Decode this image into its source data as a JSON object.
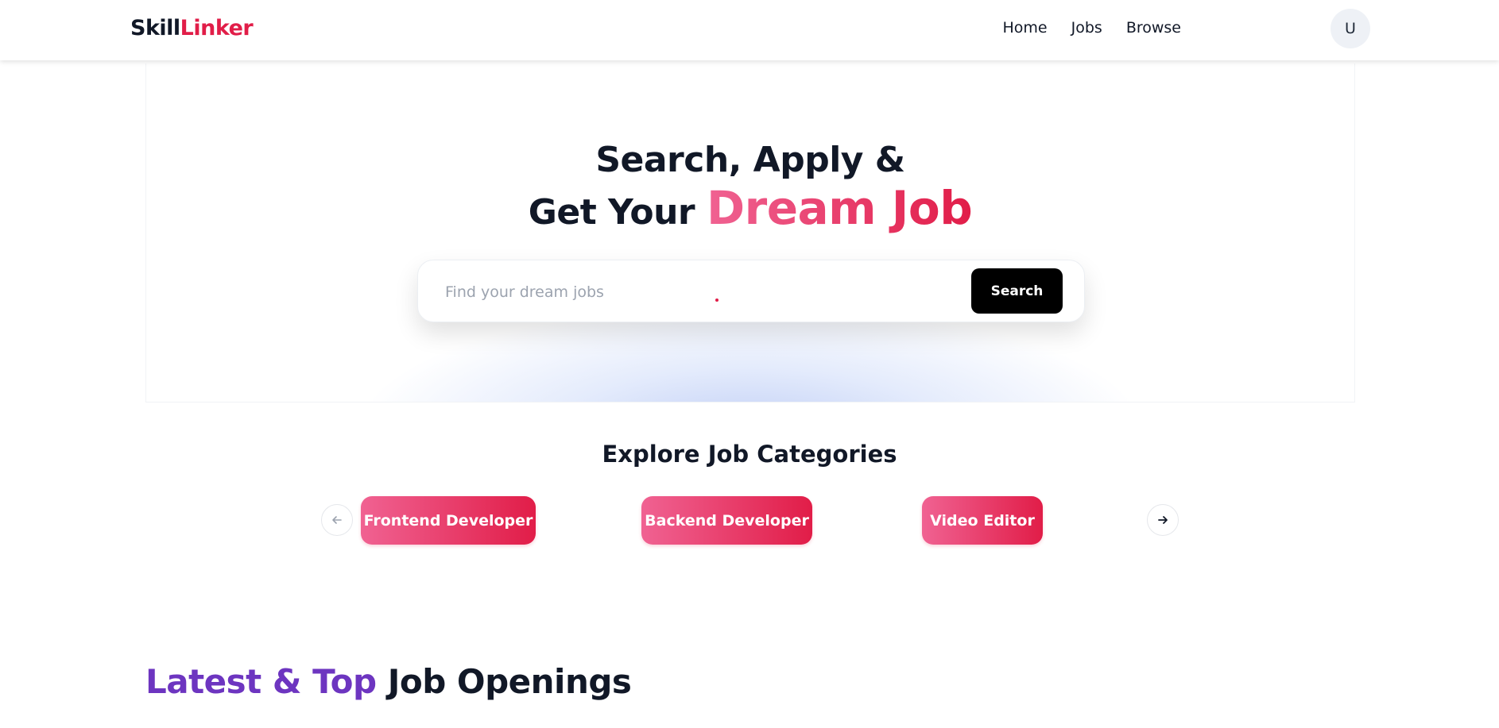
{
  "navbar": {
    "logo_part1": "Skill",
    "logo_part2": "Linker",
    "links": [
      "Home",
      "Jobs",
      "Browse"
    ],
    "avatar_initial": "U"
  },
  "hero": {
    "line1": "Search, Apply &",
    "line2_prefix": "Get Your",
    "line2_highlight": "Dream Job",
    "search_placeholder": "Find your dream jobs",
    "search_value": "",
    "search_button": "Search"
  },
  "categories": {
    "title": "Explore Job Categories",
    "items": [
      "Frontend Developer",
      "Backend Developer",
      "Video Editor"
    ],
    "prev_icon": "arrow-left-icon",
    "next_icon": "arrow-right-icon"
  },
  "latest": {
    "title_accent": "Latest & Top",
    "title_rest": "Job Openings"
  },
  "colors": {
    "brand_pink": "#e11d48",
    "pill_gradient_start": "#f06292",
    "accent_purple": "#6d35c0",
    "button_black": "#000000"
  }
}
